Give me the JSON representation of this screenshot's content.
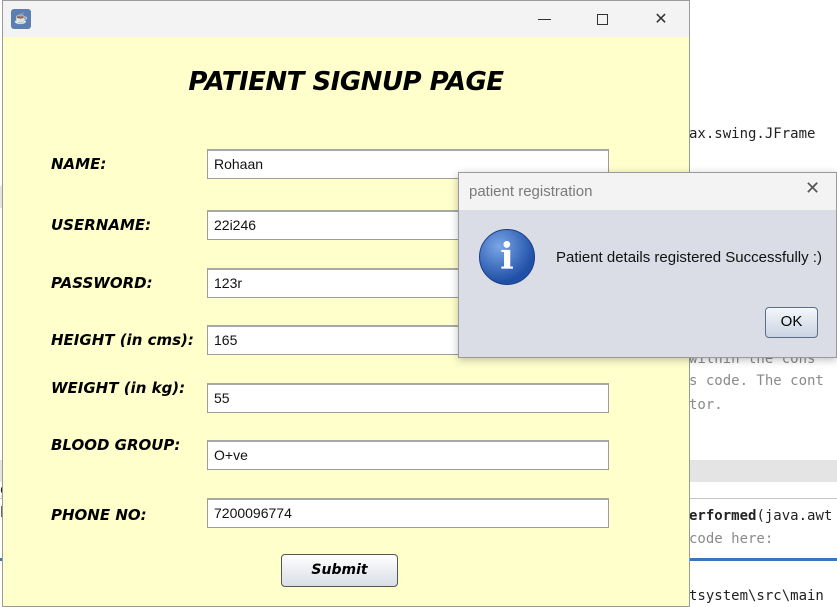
{
  "background_ide": {
    "line1": "ax.swing.JFrame",
    "line2": "within the cons",
    "line3": "s code. The cont",
    "line4": "tor.",
    "line5_bold": "erformed",
    "line5_rest": "(java.awt",
    "line6": "code here:",
    "path": "tsystem\\src\\main",
    "left_frag1": "g",
    "left_frag2": "h"
  },
  "window": {
    "icon": "java-cup-icon",
    "title": "PATIENT SIGNUP PAGE",
    "fields": [
      {
        "label": "NAME:",
        "value": "Rohaan"
      },
      {
        "label": "USERNAME:",
        "value": "22i246"
      },
      {
        "label": "PASSWORD:",
        "value": "123r"
      },
      {
        "label": "HEIGHT (in cms):",
        "value": "165"
      },
      {
        "label": "WEIGHT (in kg):",
        "value": "55"
      },
      {
        "label": "BLOOD GROUP:",
        "value": "O+ve"
      },
      {
        "label": "PHONE NO:",
        "value": "7200096774"
      }
    ],
    "submit_label": "Submit",
    "background_color": "#ffffcc"
  },
  "dialog": {
    "title": "patient registration",
    "message": "Patient details registered Successfully :)",
    "icon": "info-icon",
    "ok_label": "OK"
  }
}
